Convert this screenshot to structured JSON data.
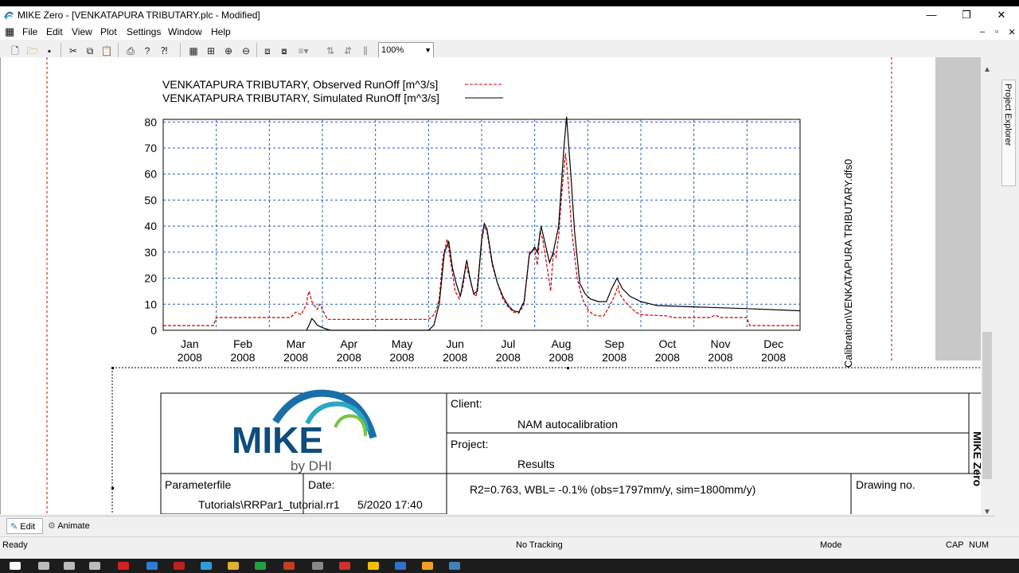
{
  "window": {
    "title": "MIKE Zero - [VENKATAPURA TRIBUTARY.plc - Modified]",
    "controls": [
      "—",
      "❐",
      "✕"
    ],
    "mdi_controls": [
      "–",
      "▫",
      "✕"
    ]
  },
  "menu": [
    "File",
    "Edit",
    "View",
    "Plot",
    "Settings",
    "Window",
    "Help"
  ],
  "toolbar": {
    "icons": [
      "new-icon",
      "open-icon",
      "save-icon",
      "cut-icon",
      "copy-icon",
      "paste-icon",
      "print-icon",
      "help-icon",
      "context-help-icon",
      "grid-icon",
      "zoom-fit-icon",
      "zoom-in-icon",
      "zoom-out-icon",
      "bring-front-icon",
      "send-back-icon",
      "align-icon",
      "distribute-v-icon",
      "distribute-h-icon",
      "equal-size-icon"
    ],
    "zoom_value": "100%"
  },
  "chart_data": {
    "type": "line",
    "series": [
      {
        "name": "VENKATAPURA TRIBUTARY, Observed RunOff [m^3/s]",
        "color": "#cc0000",
        "style": "dashed",
        "points": [
          [
            0,
            1.8
          ],
          [
            0.95,
            1.8
          ],
          [
            1.0,
            4.9
          ],
          [
            2.4,
            4.9
          ],
          [
            2.5,
            7
          ],
          [
            2.6,
            6
          ],
          [
            2.7,
            10
          ],
          [
            2.72,
            13
          ],
          [
            2.75,
            15
          ],
          [
            2.8,
            11
          ],
          [
            2.9,
            8
          ],
          [
            2.95,
            10
          ],
          [
            3.05,
            6
          ],
          [
            3.1,
            4.2
          ],
          [
            5.0,
            4.2
          ],
          [
            5.05,
            5
          ],
          [
            5.1,
            6
          ],
          [
            5.15,
            8
          ],
          [
            5.2,
            12
          ],
          [
            5.27,
            28
          ],
          [
            5.35,
            35
          ],
          [
            5.45,
            22
          ],
          [
            5.5,
            15
          ],
          [
            5.58,
            12
          ],
          [
            5.65,
            17
          ],
          [
            5.7,
            25
          ],
          [
            5.78,
            20
          ],
          [
            5.85,
            14
          ],
          [
            5.9,
            13
          ],
          [
            6.0,
            34
          ],
          [
            6.05,
            40
          ],
          [
            6.1,
            38
          ],
          [
            6.2,
            25
          ],
          [
            6.3,
            18
          ],
          [
            6.4,
            12
          ],
          [
            6.5,
            9
          ],
          [
            6.6,
            7
          ],
          [
            6.7,
            6.5
          ],
          [
            6.8,
            10
          ],
          [
            6.9,
            30
          ],
          [
            7.0,
            31
          ],
          [
            7.05,
            25
          ],
          [
            7.1,
            38
          ],
          [
            7.15,
            35
          ],
          [
            7.25,
            22
          ],
          [
            7.3,
            15
          ],
          [
            7.35,
            30
          ],
          [
            7.4,
            28
          ],
          [
            7.45,
            36
          ],
          [
            7.5,
            50
          ],
          [
            7.55,
            62
          ],
          [
            7.58,
            68
          ],
          [
            7.62,
            60
          ],
          [
            7.7,
            38
          ],
          [
            7.8,
            20
          ],
          [
            7.9,
            12
          ],
          [
            8.0,
            8
          ],
          [
            8.1,
            6
          ],
          [
            8.2,
            5.5
          ],
          [
            8.3,
            5.5
          ],
          [
            8.4,
            9
          ],
          [
            8.5,
            13
          ],
          [
            8.57,
            17
          ],
          [
            8.6,
            14
          ],
          [
            8.7,
            11
          ],
          [
            8.8,
            9
          ],
          [
            8.9,
            7
          ],
          [
            9.0,
            6
          ],
          [
            9.5,
            5.5
          ],
          [
            9.6,
            4.9
          ],
          [
            10.3,
            4.9
          ],
          [
            10.4,
            5.8
          ],
          [
            10.5,
            4.9
          ],
          [
            11.0,
            4.9
          ],
          [
            11.05,
            1.8
          ],
          [
            12,
            1.8
          ]
        ]
      },
      {
        "name": "VENKATAPURA TRIBUTARY, Simulated RunOff [m^3/s]",
        "color": "#000000",
        "style": "solid",
        "points": [
          [
            2.7,
            0
          ],
          [
            2.75,
            2
          ],
          [
            2.8,
            4.5
          ],
          [
            2.85,
            3.5
          ],
          [
            2.9,
            2
          ],
          [
            3.0,
            1
          ],
          [
            3.1,
            0.3
          ],
          [
            3.15,
            0
          ],
          [
            4.75,
            0
          ],
          [
            5.0,
            0
          ],
          [
            5.1,
            2
          ],
          [
            5.2,
            10
          ],
          [
            5.3,
            30
          ],
          [
            5.38,
            34
          ],
          [
            5.45,
            24
          ],
          [
            5.52,
            18
          ],
          [
            5.6,
            13
          ],
          [
            5.66,
            20
          ],
          [
            5.72,
            27
          ],
          [
            5.78,
            20
          ],
          [
            5.85,
            14
          ],
          [
            5.92,
            15
          ],
          [
            6.0,
            35
          ],
          [
            6.05,
            41
          ],
          [
            6.1,
            39
          ],
          [
            6.2,
            26
          ],
          [
            6.3,
            18
          ],
          [
            6.4,
            13
          ],
          [
            6.5,
            9.5
          ],
          [
            6.6,
            7.5
          ],
          [
            6.7,
            7
          ],
          [
            6.8,
            11
          ],
          [
            6.9,
            29
          ],
          [
            7.0,
            32
          ],
          [
            7.05,
            30
          ],
          [
            7.12,
            40
          ],
          [
            7.2,
            33
          ],
          [
            7.28,
            26
          ],
          [
            7.35,
            30
          ],
          [
            7.45,
            40
          ],
          [
            7.5,
            55
          ],
          [
            7.55,
            70
          ],
          [
            7.6,
            82
          ],
          [
            7.68,
            60
          ],
          [
            7.75,
            38
          ],
          [
            7.85,
            18
          ],
          [
            7.95,
            14
          ],
          [
            8.05,
            12
          ],
          [
            8.2,
            11
          ],
          [
            8.35,
            11
          ],
          [
            8.45,
            16
          ],
          [
            8.55,
            20
          ],
          [
            8.65,
            16
          ],
          [
            8.8,
            13
          ],
          [
            9.0,
            11
          ],
          [
            9.3,
            9.5
          ],
          [
            10.0,
            9
          ],
          [
            11.0,
            8.3
          ],
          [
            12,
            7.5
          ]
        ]
      }
    ],
    "x_ticks": [
      {
        "label": "Jan",
        "year": "2008"
      },
      {
        "label": "Feb",
        "year": "2008"
      },
      {
        "label": "Mar",
        "year": "2008"
      },
      {
        "label": "Apr",
        "year": "2008"
      },
      {
        "label": "May",
        "year": "2008"
      },
      {
        "label": "Jun",
        "year": "2008"
      },
      {
        "label": "Jul",
        "year": "2008"
      },
      {
        "label": "Aug",
        "year": "2008"
      },
      {
        "label": "Sep",
        "year": "2008"
      },
      {
        "label": "Oct",
        "year": "2008"
      },
      {
        "label": "Nov",
        "year": "2008"
      },
      {
        "label": "Dec",
        "year": "2008"
      }
    ],
    "y_ticks": [
      0,
      10,
      20,
      30,
      40,
      50,
      60,
      70,
      80
    ],
    "ylim": [
      0,
      81
    ],
    "xlim": [
      0,
      12
    ],
    "grid": true,
    "side_label": "Calibration\\VENKATAPURA TRIBUTARY.dfs0"
  },
  "title_block": {
    "logo_text": "MIKE",
    "logo_sub": "by DHI",
    "client_label": "Client:",
    "client_value": "NAM autocalibration",
    "project_label": "Project:",
    "project_value": "Results",
    "parameterfile_label": "Parameterfile",
    "parameterfile_value": "Tutorials\\RRPar1_tutorial.rr1",
    "date_label": "Date:",
    "date_value": "5/2020 17:40",
    "stats": "R2=0.763, WBL= -0.1% (obs=1797mm/y, sim=1800mm/y)",
    "drawing_label": "Drawing no."
  },
  "bottom_tabs": [
    "Edit",
    "Animate"
  ],
  "status": {
    "left": "Ready",
    "center": "No Tracking",
    "mode": "Mode",
    "cap": "CAP",
    "num": "NUM"
  },
  "right_panel": {
    "tab": "Project Explorer"
  }
}
